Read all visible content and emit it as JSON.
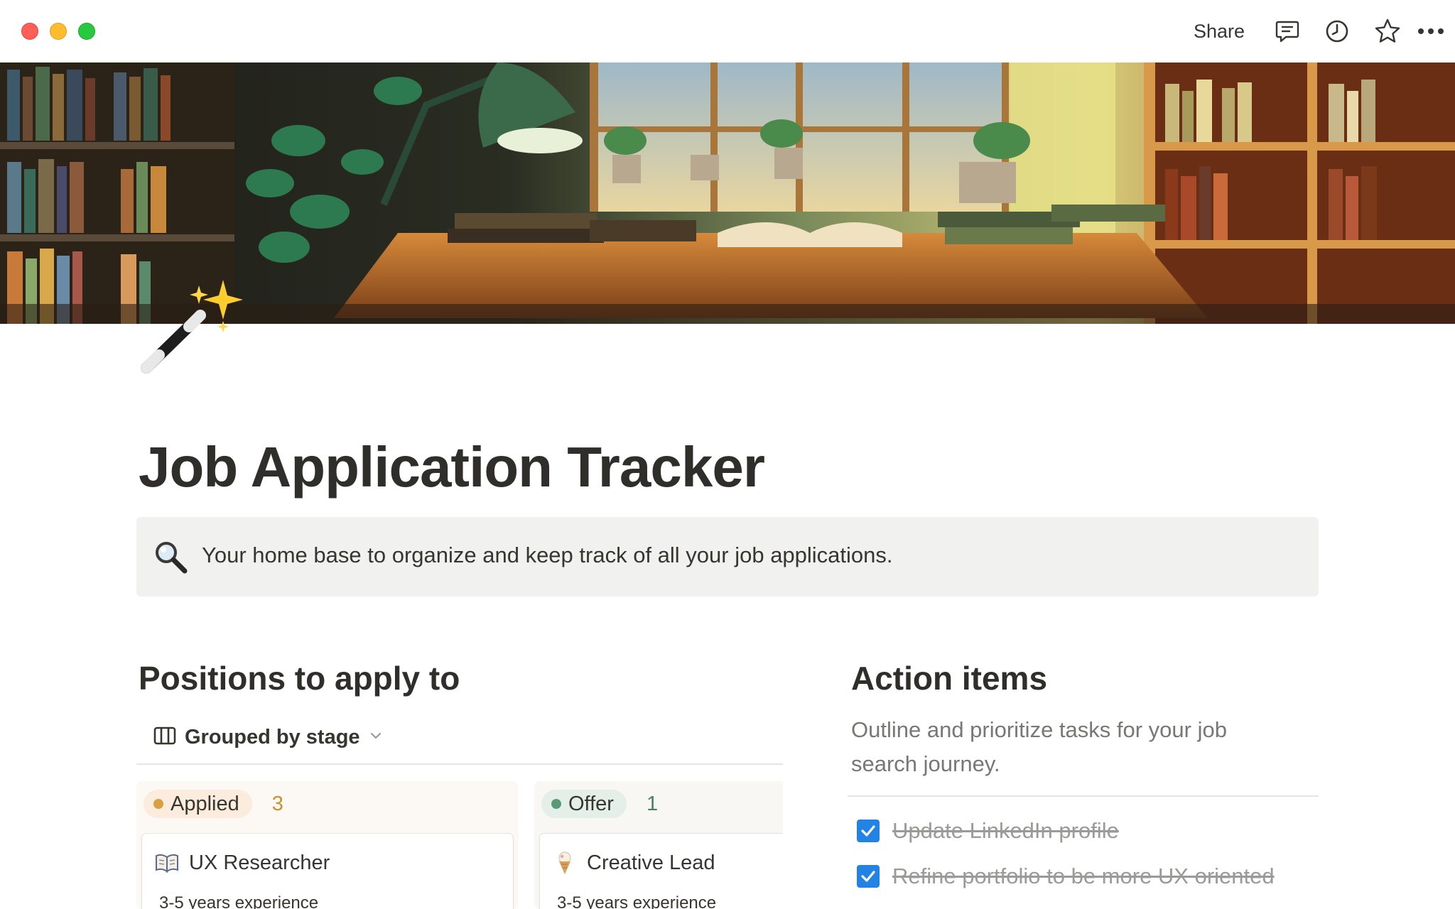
{
  "topbar": {
    "share_label": "Share",
    "icons": [
      "comment-icon",
      "clock-icon",
      "star-icon",
      "more-icon"
    ]
  },
  "cover": {
    "description_icon": "library-desk-illustration"
  },
  "page": {
    "icon": "magic-wand-icon",
    "title": "Job Application Tracker"
  },
  "callout": {
    "icon": "magnifying-glass-icon",
    "text": "Your home base to organize and keep track of all your job applications."
  },
  "positions": {
    "heading": "Positions to apply to",
    "view_label": "Grouped by stage",
    "columns": [
      {
        "label": "Applied",
        "count": "3",
        "color": "#d9a040",
        "cards": [
          {
            "icon": "book-icon",
            "title": "UX Researcher",
            "subtitle": "3-5 years experience"
          }
        ]
      },
      {
        "label": "Offer",
        "count": "1",
        "color": "#5b9a76",
        "cards": [
          {
            "icon": "ice-cream-icon",
            "title": "Creative Lead",
            "subtitle": "3-5 years experience"
          }
        ]
      }
    ]
  },
  "action_items": {
    "heading": "Action items",
    "description": "Outline and prioritize tasks for your job search journey.",
    "todos": [
      {
        "text": "Update LinkedIn profile",
        "checked": true
      },
      {
        "text": "Refine portfolio to be more UX oriented",
        "checked": true
      }
    ]
  },
  "colors": {
    "accent_blue": "#2383e2",
    "callout_bg": "#f1f1ef",
    "applied_pill": "#fbecdd",
    "offer_pill": "#e3efe8"
  }
}
